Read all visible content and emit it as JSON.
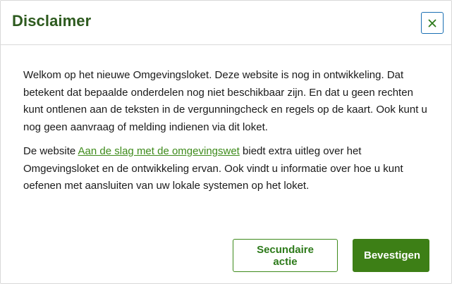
{
  "dialog": {
    "title": "Disclaimer",
    "close_icon": "close-icon",
    "paragraph1": "Welkom op het nieuwe Omgevingsloket. Deze website is nog in ontwikkeling. Dat betekent dat bepaalde onderdelen nog niet beschikbaar zijn. En dat u geen rechten kunt ontlenen aan de teksten in de vergunningcheck en regels op de kaart. Ook kunt u nog geen aanvraag of melding indienen via dit loket.",
    "paragraph2_before": "De website ",
    "paragraph2_link": "Aan de slag met de omgevingswet",
    "paragraph2_after": " biedt extra uitleg over het Omgevingsloket en de ontwikkeling ervan. Ook vindt u informatie over hoe u kunt oefenen met aansluiten van uw lokale systemen op het loket.",
    "secondary_label": "Secundaire actie",
    "primary_label": "Bevestigen"
  },
  "colors": {
    "title": "#2d5a1e",
    "link": "#3d8a1a",
    "primary_bg": "#3d7f16",
    "close_border": "#1a6fb3"
  }
}
